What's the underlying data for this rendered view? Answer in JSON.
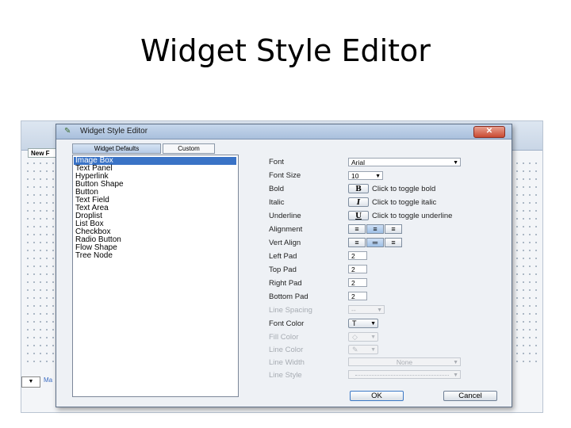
{
  "slide": {
    "title": "Widget Style Editor"
  },
  "background_app": {
    "tab_label": "New F",
    "dropdown_arrow": "▼",
    "link_text": "Ma"
  },
  "dialog": {
    "title": "Widget Style Editor",
    "close_glyph": "✕",
    "tabs": [
      {
        "label": "Widget Defaults",
        "active": true
      },
      {
        "label": "Custom",
        "active": false
      }
    ],
    "widget_list": [
      "Image Box",
      "Text Panel",
      "Hyperlink",
      "Button Shape",
      "Button",
      "Text Field",
      "Text Area",
      "Droplist",
      "List Box",
      "Checkbox",
      "Radio Button",
      "Flow Shape",
      "Tree Node"
    ],
    "selected_index": 0,
    "properties": {
      "font": {
        "label": "Font",
        "value": "Arial"
      },
      "font_size": {
        "label": "Font Size",
        "value": "10"
      },
      "bold": {
        "label": "Bold",
        "glyph": "B",
        "hint": "Click to toggle bold"
      },
      "italic": {
        "label": "Italic",
        "glyph": "I",
        "hint": "Click to toggle italic"
      },
      "underline": {
        "label": "Underline",
        "glyph": "U",
        "hint": "Click to toggle underline"
      },
      "alignment": {
        "label": "Alignment",
        "selected": "center"
      },
      "vert_align": {
        "label": "Vert Align",
        "selected": "middle"
      },
      "left_pad": {
        "label": "Left Pad",
        "value": "2"
      },
      "top_pad": {
        "label": "Top Pad",
        "value": "2"
      },
      "right_pad": {
        "label": "Right Pad",
        "value": "2"
      },
      "bottom_pad": {
        "label": "Bottom Pad",
        "value": "2"
      },
      "line_spacing": {
        "label": "Line Spacing",
        "value": "--",
        "enabled": false
      },
      "font_color": {
        "label": "Font Color",
        "glyph": "T",
        "enabled": true
      },
      "fill_color": {
        "label": "Fill Color",
        "glyph": "◇",
        "enabled": false
      },
      "line_color": {
        "label": "Line Color",
        "glyph": "✎",
        "enabled": false
      },
      "line_width": {
        "label": "Line Width",
        "value": "None",
        "enabled": false
      },
      "line_style": {
        "label": "Line Style",
        "value": "",
        "enabled": false
      }
    },
    "buttons": {
      "ok": "OK",
      "cancel": "Cancel"
    }
  }
}
